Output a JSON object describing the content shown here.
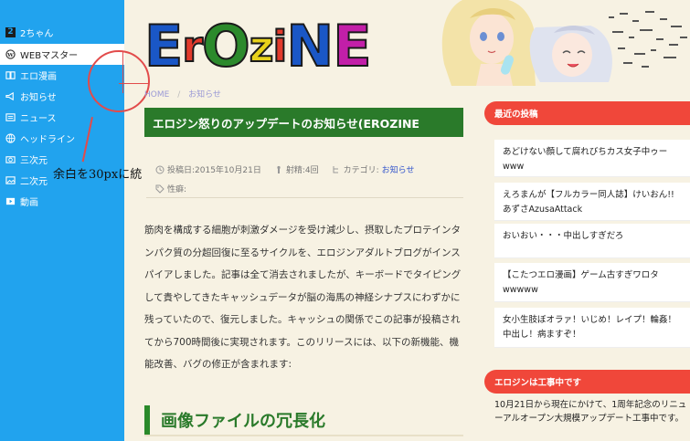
{
  "sidebar": {
    "items": [
      {
        "label": "2ちゃん",
        "icon": "square-2-icon"
      },
      {
        "label": "WEBマスター",
        "icon": "wordpress-icon"
      },
      {
        "label": "エロ漫画",
        "icon": "book-icon"
      },
      {
        "label": "お知らせ",
        "icon": "megaphone-icon"
      },
      {
        "label": "ニュース",
        "icon": "newspaper-icon"
      },
      {
        "label": "ヘッドライン",
        "icon": "globe-icon"
      },
      {
        "label": "三次元",
        "icon": "camera-icon"
      },
      {
        "label": "二次元",
        "icon": "image-icon"
      },
      {
        "label": "動画",
        "icon": "film-icon"
      }
    ]
  },
  "header": {
    "logo": {
      "letters": [
        "E",
        "r",
        "O",
        "z",
        "i",
        "N",
        "E"
      ]
    }
  },
  "annotation": {
    "text": "余白を30pxに統"
  },
  "breadcrumb": {
    "home": "HOME",
    "separator": "/",
    "current": "お知らせ"
  },
  "article": {
    "title": "エロジン怒りのアップデートのお知らせ(EROZINE",
    "meta": {
      "posted_date": "投稿日:2015年10月21日",
      "shots": "射精:4回",
      "category_label": "カテゴリ:",
      "category_link": "お知らせ",
      "fetish_label": "性癖:"
    },
    "body": "筋肉を構成する細胞が刺激ダメージを受け減少し、摂取したプロテインタンパク質の分超回復に至るサイクルを、エロジンアダルトブログがインスパイアしました。記事は全て消去されましたが、キーボードでタイピングして貴やしてきたキャッシュデータが脳の海馬の神経シナプスにわずかに残っていたので、復元しました。キャッシュの関係でこの記事が投稿されてから700時間後に実現されます。このリリースには、以下の新機能、機能改善、バグの修正が含まれます:",
    "section_heading": "画像ファイルの冗長化"
  },
  "right_sidebar": {
    "recent_heading": "最近の投稿",
    "recent_posts": [
      "あどけない顔して腐れびちカス女子中ゥーwww",
      "えろまんが【フルカラー同人誌】けいおん!!あずさAzusaAttack",
      "おいおい・・・中出しすぎだろ",
      "【こたつエロ漫画】ゲーム古すぎワロタwwwww",
      "女小生肢ぼオラァ！いじめ！レイプ！輪姦！中出し！病ますぞ！"
    ],
    "notice_heading": "エロジンは工事中です",
    "notice_text": "10月21日から現在にかけて、1周年記念のリニューアルオープン大規模アップデート工事中です。"
  },
  "colors": {
    "sidebar_bg": "#21a3ee",
    "title_bar": "#2a7a2a",
    "widget_head": "#f0473a",
    "page_bg": "#f7f2e3",
    "annotation": "#e24b4b"
  }
}
